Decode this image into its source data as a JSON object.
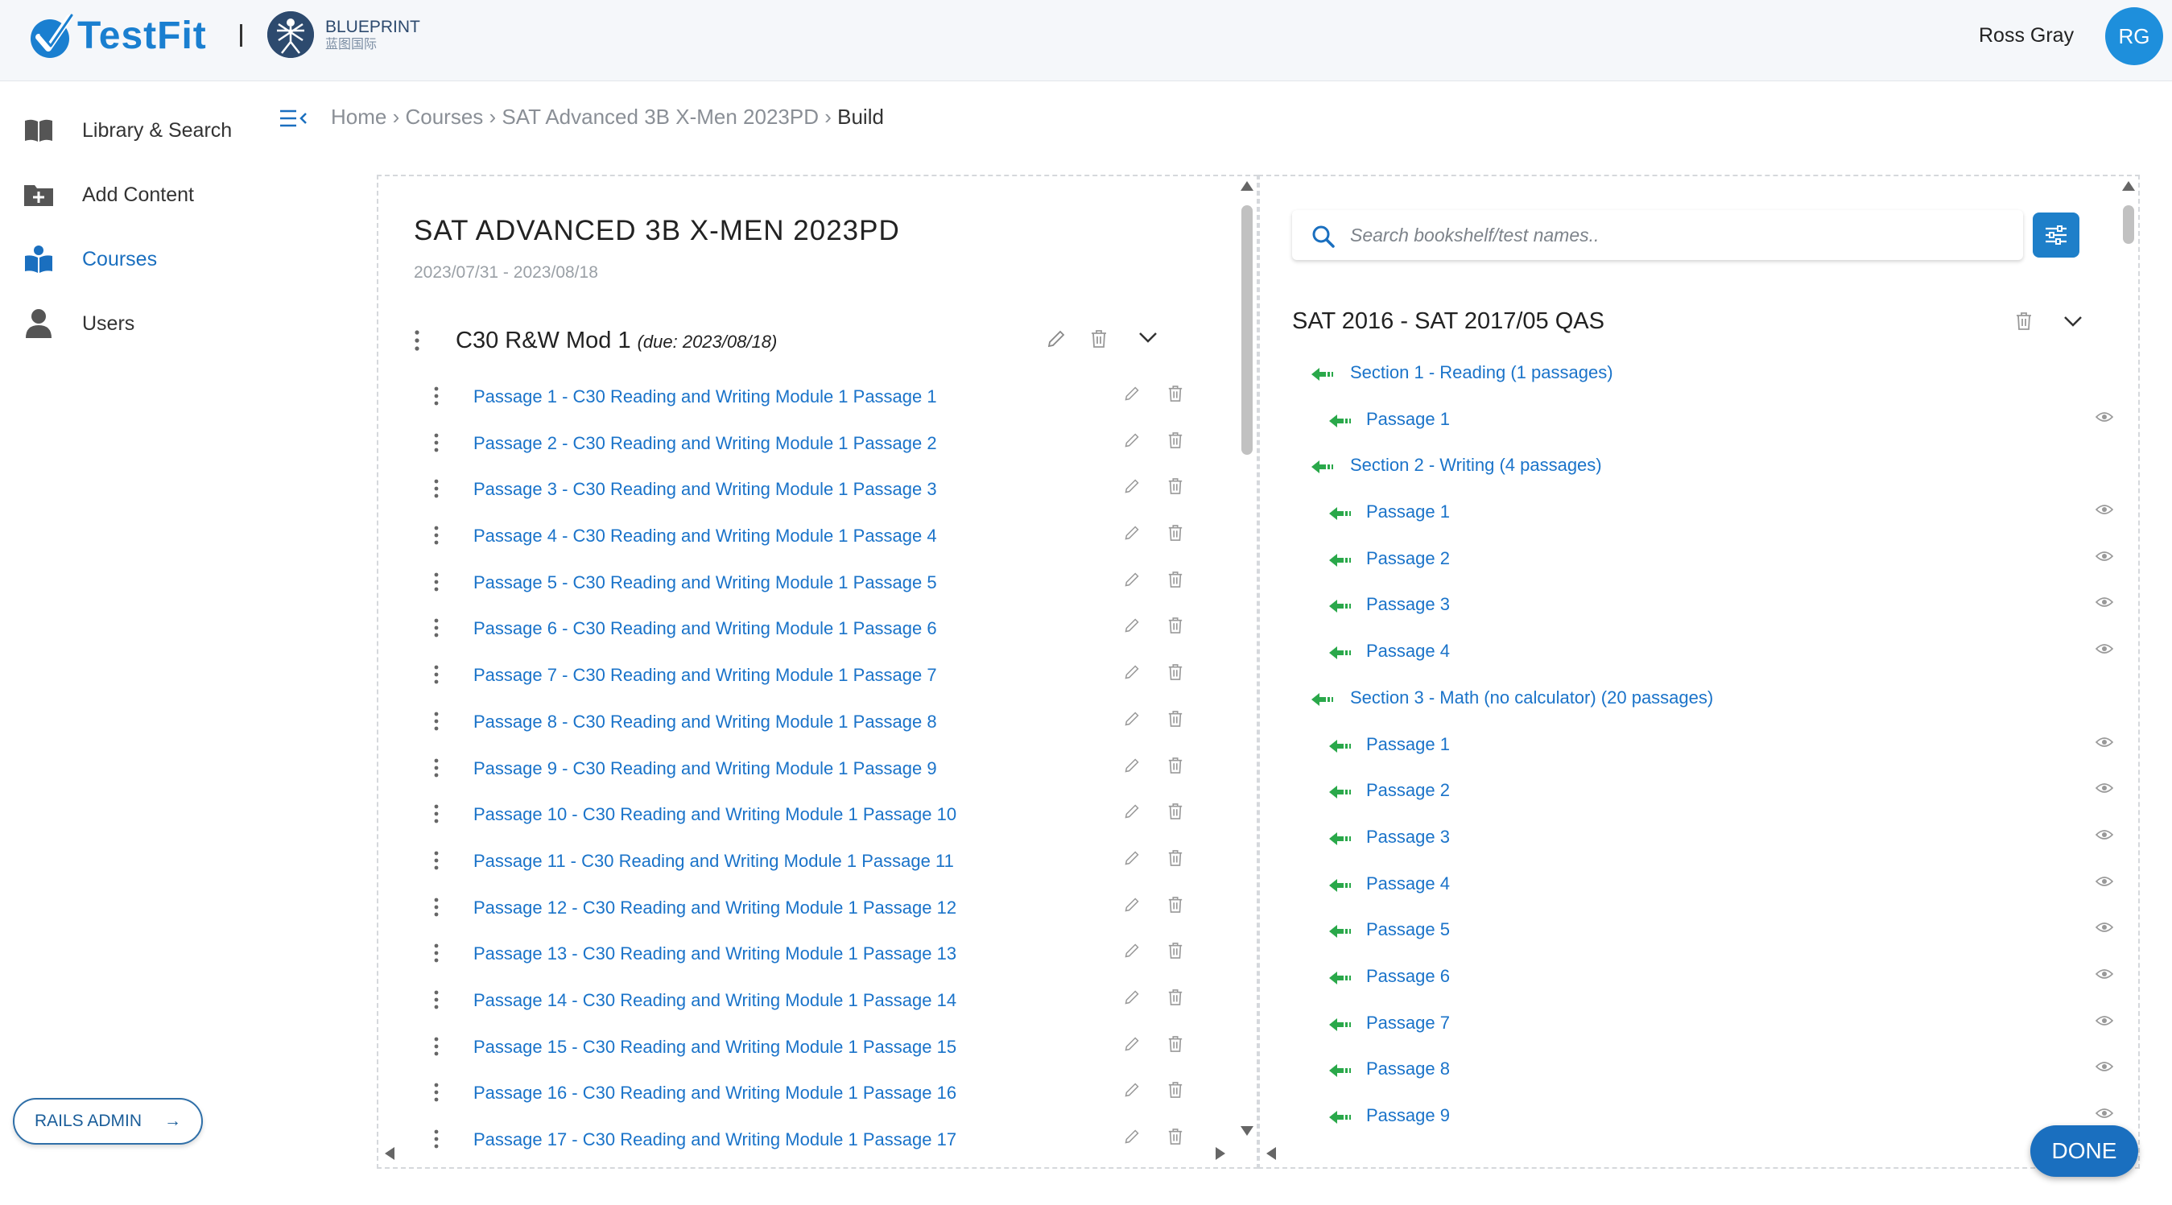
{
  "header": {
    "logo_text": "TestFit",
    "partner_name": "BLUEPRINT",
    "partner_subtitle": "蓝图国际",
    "user_name": "Ross Gray",
    "user_initials": "RG",
    "brand_color": "#1a7fd0"
  },
  "sidebar": {
    "items": [
      {
        "label": "Library & Search",
        "icon": "book-icon"
      },
      {
        "label": "Add Content",
        "icon": "folder-plus-icon"
      },
      {
        "label": "Courses",
        "icon": "courses-icon",
        "active": true
      },
      {
        "label": "Users",
        "icon": "user-icon"
      }
    ],
    "rails_admin_label": "RAILS ADMIN",
    "rails_admin_arrow": "→"
  },
  "breadcrumb": {
    "trail": "Home › Courses › SAT Advanced 3B X-Men 2023PD ›",
    "current": "Build"
  },
  "course": {
    "title": "SAT ADVANCED 3B X-MEN 2023PD",
    "dates": "2023/07/31 - 2023/08/18",
    "module": {
      "name": "C30 R&W Mod 1",
      "due": "(due: 2023/08/18)",
      "passages": [
        "Passage 1 - C30 Reading and Writing Module 1 Passage 1",
        "Passage 2 - C30 Reading and Writing Module 1 Passage 2",
        "Passage 3 - C30 Reading and Writing Module 1 Passage 3",
        "Passage 4 - C30 Reading and Writing Module 1 Passage 4",
        "Passage 5 - C30 Reading and Writing Module 1 Passage 5",
        "Passage 6 - C30 Reading and Writing Module 1 Passage 6",
        "Passage 7 - C30 Reading and Writing Module 1 Passage 7",
        "Passage 8 - C30 Reading and Writing Module 1 Passage 8",
        "Passage 9 - C30 Reading and Writing Module 1 Passage 9",
        "Passage 10 - C30 Reading and Writing Module 1 Passage 10",
        "Passage 11 - C30 Reading and Writing Module 1 Passage 11",
        "Passage 12 - C30 Reading and Writing Module 1 Passage 12",
        "Passage 13 - C30 Reading and Writing Module 1 Passage 13",
        "Passage 14 - C30 Reading and Writing Module 1 Passage 14",
        "Passage 15 - C30 Reading and Writing Module 1 Passage 15",
        "Passage 16 - C30 Reading and Writing Module 1 Passage 16",
        "Passage 17 - C30 Reading and Writing Module 1 Passage 17"
      ]
    }
  },
  "library": {
    "search_placeholder": "Search bookshelf/test names..",
    "bookshelf_title": "SAT 2016 - SAT 2017/05 QAS",
    "tree": [
      {
        "type": "section",
        "label": "Section 1 - Reading (1 passages)"
      },
      {
        "type": "passage",
        "label": "Passage 1"
      },
      {
        "type": "section",
        "label": "Section 2 - Writing (4 passages)"
      },
      {
        "type": "passage",
        "label": "Passage 1"
      },
      {
        "type": "passage",
        "label": "Passage 2"
      },
      {
        "type": "passage",
        "label": "Passage 3"
      },
      {
        "type": "passage",
        "label": "Passage 4"
      },
      {
        "type": "section",
        "label": "Section 3 - Math (no calculator) (20 passages)"
      },
      {
        "type": "passage",
        "label": "Passage 1"
      },
      {
        "type": "passage",
        "label": "Passage 2"
      },
      {
        "type": "passage",
        "label": "Passage 3"
      },
      {
        "type": "passage",
        "label": "Passage 4"
      },
      {
        "type": "passage",
        "label": "Passage 5"
      },
      {
        "type": "passage",
        "label": "Passage 6"
      },
      {
        "type": "passage",
        "label": "Passage 7"
      },
      {
        "type": "passage",
        "label": "Passage 8"
      },
      {
        "type": "passage",
        "label": "Passage 9"
      }
    ],
    "arrow_color": "#2aa84a"
  },
  "done_label": "DONE"
}
